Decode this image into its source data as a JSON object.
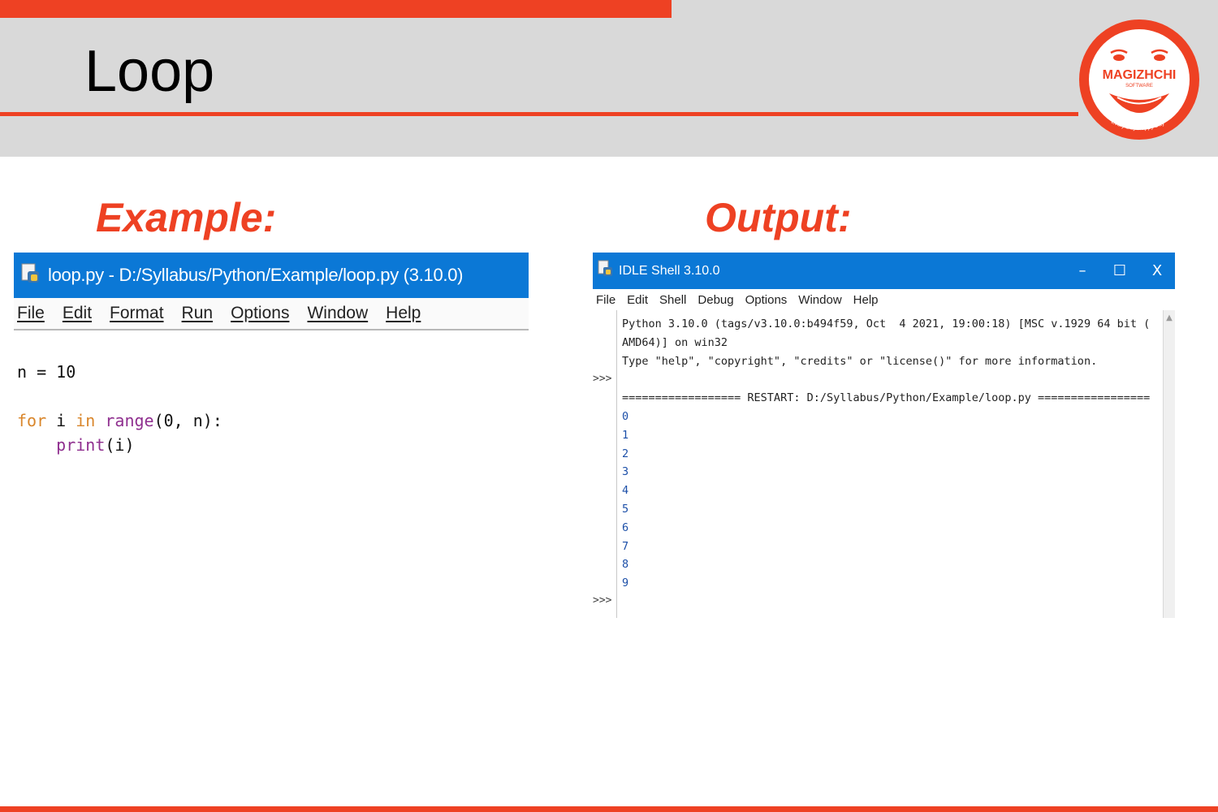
{
  "slide": {
    "title": "Loop",
    "example_label": "Example:",
    "output_label": "Output:"
  },
  "logo": {
    "brand": "MAGIZHCHI",
    "sub": "SOFTWARE",
    "tagline": "Every Day Happy Day"
  },
  "editor": {
    "title": "loop.py - D:/Syllabus/Python/Example/loop.py (3.10.0)",
    "menu": [
      "File",
      "Edit",
      "Format",
      "Run",
      "Options",
      "Window",
      "Help"
    ],
    "code": {
      "line1": "n = 10",
      "for_kw": "for",
      "for_var": " i ",
      "in_kw": "in",
      "range_fn": " range",
      "range_args": "(0, n):",
      "indent": "    ",
      "print_fn": "print",
      "print_args": "(i)"
    }
  },
  "shell": {
    "title": "IDLE Shell 3.10.0",
    "window_buttons": {
      "minimize": "–",
      "maximize": "☐",
      "close": "X"
    },
    "menu": [
      "File",
      "Edit",
      "Shell",
      "Debug",
      "Options",
      "Window",
      "Help"
    ],
    "prompt": ">>>",
    "banner_line1": "Python 3.10.0 (tags/v3.10.0:b494f59, Oct  4 2021, 19:00:18) [MSC v.1929 64 bit (",
    "banner_line2": "AMD64)] on win32",
    "banner_line3": "Type \"help\", \"copyright\", \"credits\" or \"license()\" for more information.",
    "restart_line": "================== RESTART: D:/Syllabus/Python/Example/loop.py =================",
    "output": [
      "0",
      "1",
      "2",
      "3",
      "4",
      "5",
      "6",
      "7",
      "8",
      "9"
    ]
  },
  "colors": {
    "accent": "#ee4123",
    "titlebar": "#0b78d6",
    "header_bg": "#d9d9d9"
  }
}
